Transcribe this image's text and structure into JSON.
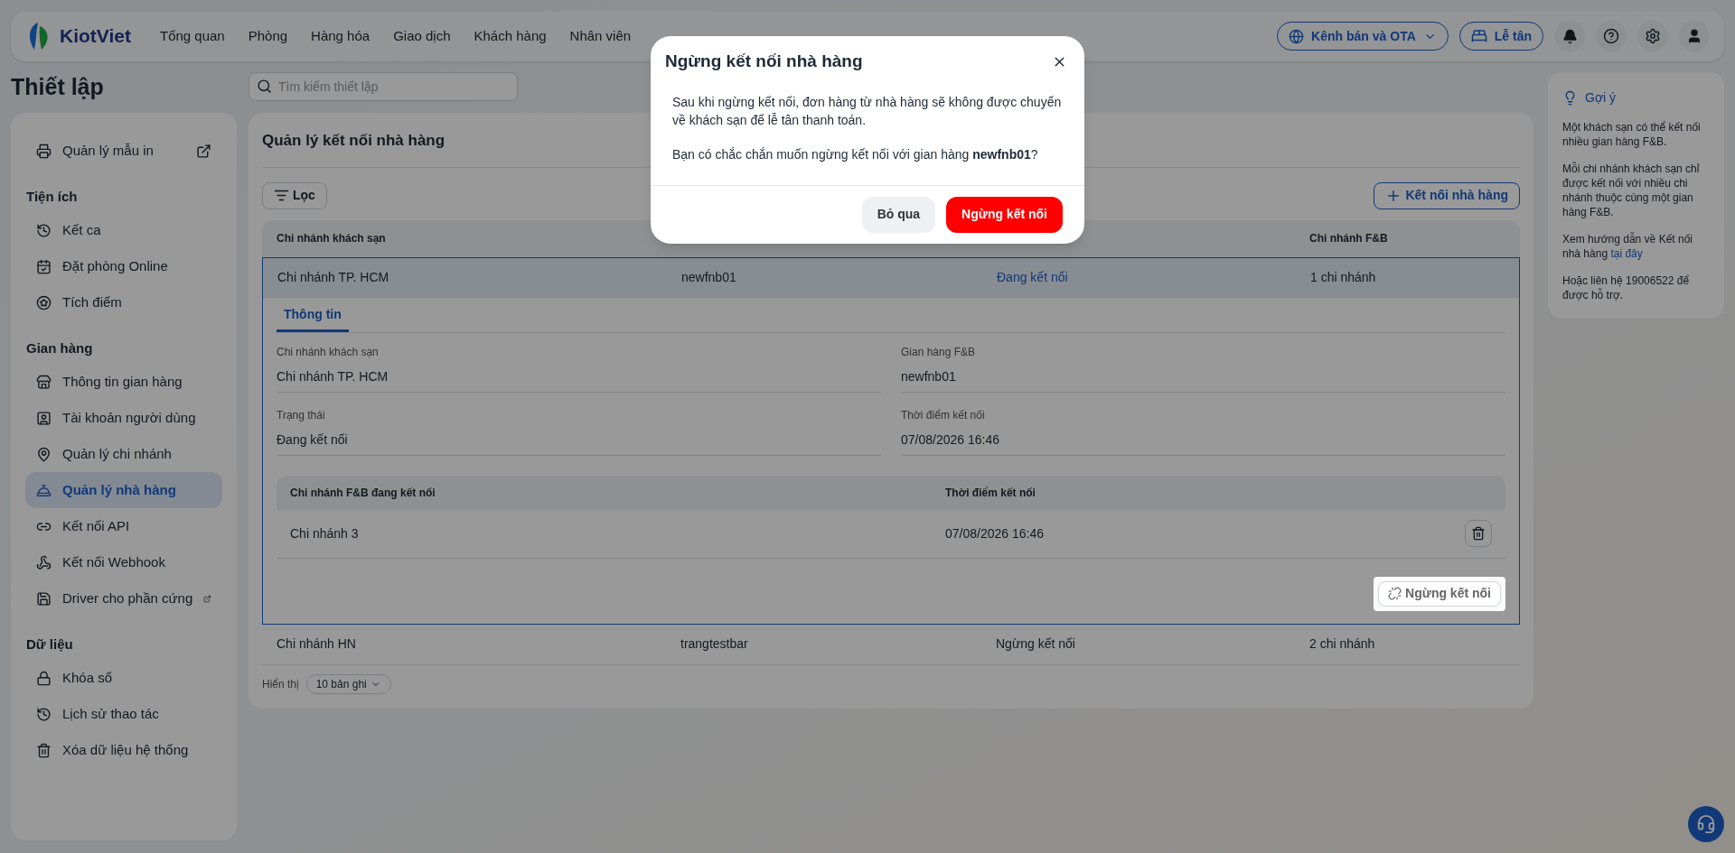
{
  "topbar": {
    "logo": "KiotViet",
    "nav": [
      "Tổng quan",
      "Phòng",
      "Hàng hóa",
      "Giao dịch",
      "Khách hàng",
      "Nhân viên"
    ],
    "channel_button": "Kênh bán và OTA",
    "reception_button": "Lễ tân"
  },
  "page_title": "Thiết lập",
  "search": {
    "placeholder": "Tìm kiếm thiết lập"
  },
  "sidebar": {
    "sections": [
      {
        "items": [
          {
            "label": "Quản lý mẫu in",
            "external": true,
            "selected": false
          }
        ]
      },
      {
        "title": "Tiện ích",
        "items": [
          {
            "label": "Kết ca",
            "external": false,
            "selected": false
          },
          {
            "label": "Đặt phòng Online",
            "external": false,
            "selected": false
          },
          {
            "label": "Tích điểm",
            "external": false,
            "selected": false
          }
        ]
      },
      {
        "title": "Gian hàng",
        "items": [
          {
            "label": "Thông tin gian hàng",
            "external": false,
            "selected": false
          },
          {
            "label": "Tài khoản người dùng",
            "external": false,
            "selected": false
          },
          {
            "label": "Quản lý chi nhánh",
            "external": false,
            "selected": false
          },
          {
            "label": "Quản lý nhà hàng",
            "external": false,
            "selected": true
          },
          {
            "label": "Kết nối API",
            "external": false,
            "selected": false
          },
          {
            "label": "Kết nối Webhook",
            "external": false,
            "selected": false
          },
          {
            "label": "Driver cho phần cứng",
            "external": true,
            "selected": false
          }
        ]
      },
      {
        "title": "Dữ liệu",
        "items": [
          {
            "label": "Khóa sổ",
            "external": false,
            "selected": false
          },
          {
            "label": "Lịch sử thao tác",
            "external": false,
            "selected": false
          },
          {
            "label": "Xóa dữ liệu hệ thống",
            "external": false,
            "selected": false
          }
        ]
      }
    ]
  },
  "main": {
    "title": "Quản lý kết nối nhà hàng",
    "filter_button": "Lọc",
    "add_button": "Kết nối nhà hàng",
    "table": {
      "headings": {
        "column_1": "Chi nhánh khách sạn",
        "column_4": "Chi nhánh F&B"
      },
      "rows": [
        {
          "cells": [
            "Chi nhánh TP. HCM",
            "newfnb01",
            "Đang kết nối",
            "1 chi nhánh"
          ],
          "connected": true,
          "expanded": true,
          "selected": true,
          "detail": {
            "tab": "Thông tin",
            "fields": [
              {
                "label": "Chi nhánh khách sạn",
                "value": "Chi nhánh TP. HCM"
              },
              {
                "label": "Gian hàng F&B",
                "value": "newfnb01"
              },
              {
                "label": "Trạng thái",
                "value": "Đang kết nối"
              },
              {
                "label": "Thời điểm kết nối",
                "value": "07/08/2026 16:46"
              }
            ],
            "subtable": {
              "headings": [
                "Chi nhánh F&B đang kết nối",
                "Thời điểm kết nối"
              ],
              "rows": [
                [
                  "Chi nhánh 3",
                  "07/08/2026 16:46"
                ]
              ]
            },
            "disconnect_button": "Ngừng kết nối"
          }
        },
        {
          "cells": [
            "Chi nhánh HN",
            "trangtestbar",
            "Ngừng kết nối",
            "2 chi nhánh"
          ],
          "connected": false,
          "expanded": false,
          "selected": false
        }
      ]
    },
    "pager": {
      "label": "Hiển thị",
      "value": "10 bản ghi"
    }
  },
  "hint": {
    "title": "Gợi ý",
    "paragraphs": [
      {
        "text": "Một khách sạn có thể kết nối nhiều gian hàng F&B."
      },
      {
        "text": "Mỗi chi nhánh khách sạn chỉ được kết nối với nhiều chi nhánh thuộc cùng một gian hàng F&B."
      },
      {
        "text": "Xem hướng dẫn về Kết nối nhà hàng",
        "link": "tại đây"
      },
      {
        "text": "Hoặc liên hệ 19006522 để được hỗ trợ."
      }
    ]
  },
  "dialog": {
    "title": "Ngừng kết nối nhà hàng",
    "paragraphs": [
      "Sau khi ngừng kết nối, đơn hàng từ nhà hàng sẽ không được chuyển về khách sạn để lễ tân thanh toán.",
      "Bạn có chắc chắn muốn ngừng kết nối với gian hàng **newfnb01**?"
    ],
    "cancel_button": "Bỏ qua",
    "confirm_button": "Ngừng kết nối"
  }
}
